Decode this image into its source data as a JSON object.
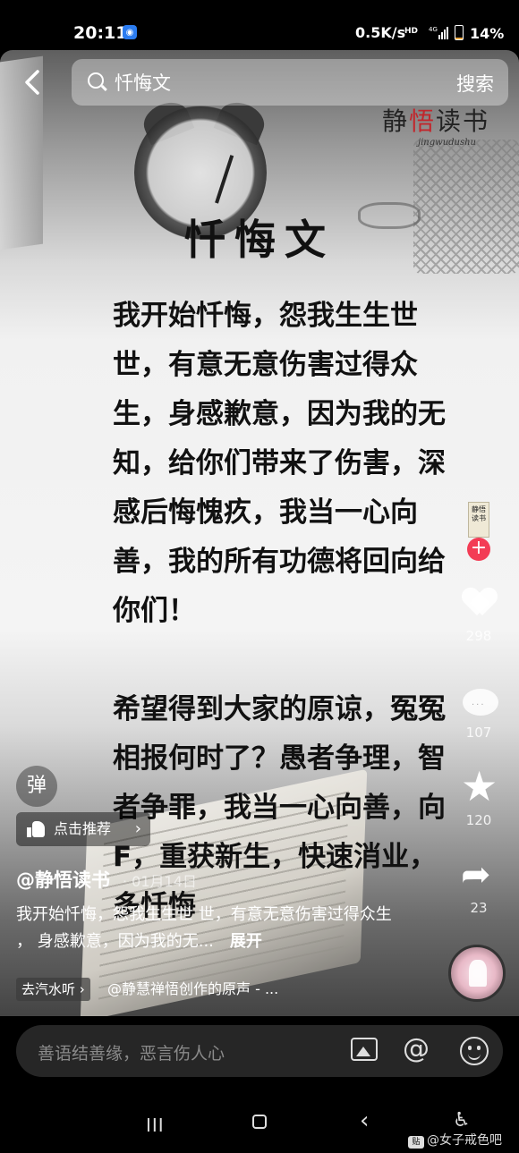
{
  "status_bar": {
    "time": "20:11",
    "network_speed": "0.5K/s",
    "hd": "HD",
    "signal": "4G",
    "battery": "14%",
    "battery_level": 0.14
  },
  "search": {
    "back_label": "‹",
    "query": "忏悔文",
    "button_label": "搜索"
  },
  "watermark": {
    "logo_prefix": "静",
    "logo_highlight": "悟",
    "logo_suffix": "读书",
    "script": "jingwudushu"
  },
  "poster": {
    "title": "忏悔文",
    "paragraph_1": "我开始忏悔，怨我生生世世，有意无意伤害过得众生，身感歉意，因为我的无知，给你们带来了伤害，深感后悔愧疚，我当一心向善，我的所有功德将回向给你们！",
    "paragraph_2": "希望得到大家的原谅，冤冤相报何时了？愚者争理，智者争罪，我当一心向善，向F，重获新生，快速消业，多忏悔"
  },
  "right_rail": {
    "avatar_text": "静悟读书",
    "follow": "+",
    "likes": "298",
    "comments": "107",
    "favorites": "120",
    "shares": "23"
  },
  "overlay": {
    "danmaku": "弹",
    "recommend": "点击推荐",
    "recommend_arrow": "›",
    "author": "@静悟读书",
    "date": "· 01月14日",
    "caption": "我开始忏悔，怨我生生世 世，有意无意伤害过得众生 ， 身感歉意，因为我的无...",
    "expand": "展开",
    "listen": "去汽水听 ›",
    "sound": "@静慧禅悟创作的原声 - ..."
  },
  "comment_bar": {
    "placeholder": "善语结善缘，恶言伤人心",
    "at": "@"
  },
  "nav_bar": {
    "recent": "III",
    "back": "‹",
    "accessibility": "♿",
    "forum_badge": "贴",
    "forum_name": "@女子戒色吧"
  },
  "icons": [
    "back-icon",
    "search-icon",
    "heart-icon",
    "comment-icon",
    "star-icon",
    "share-icon",
    "thumb-icon",
    "image-icon",
    "at-icon",
    "emoji-icon",
    "home-icon",
    "recent-apps-icon",
    "nav-back-icon",
    "accessibility-icon"
  ],
  "colors": {
    "follow": "#f33c55",
    "logo_red": "#c2262c",
    "battery": "#e9a23b",
    "app_badge": "#2b7cf0"
  }
}
